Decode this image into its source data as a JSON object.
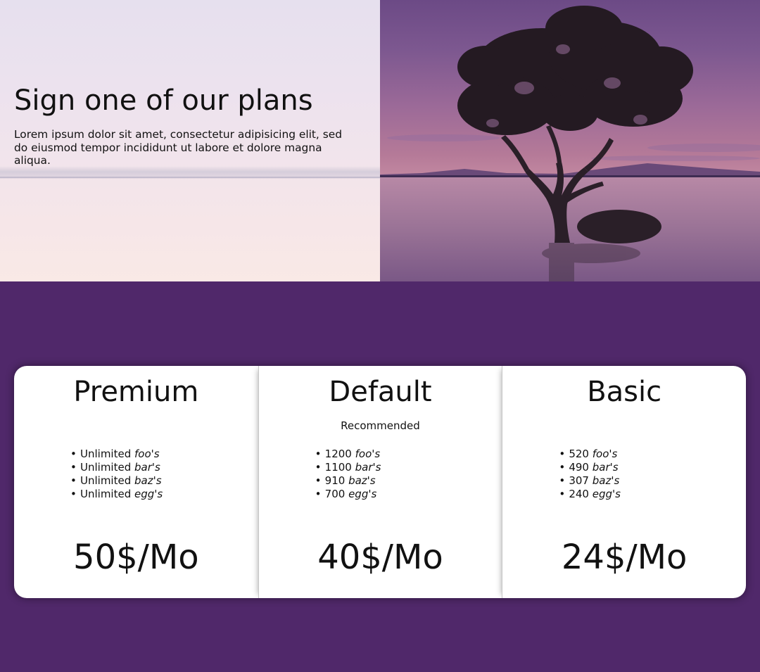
{
  "hero": {
    "title": "Sign one of our plans",
    "description": "Lorem ipsum dolor sit amet, consectetur adipisicing elit, sed do eiusmod tempor incididunt ut labore et dolore magna aliqua."
  },
  "plans": [
    {
      "name": "Premium",
      "tag": "",
      "features": [
        {
          "amount": "Unlimited",
          "unit": "foo's"
        },
        {
          "amount": "Unlimited",
          "unit": "bar's"
        },
        {
          "amount": "Unlimited",
          "unit": "baz's"
        },
        {
          "amount": "Unlimited",
          "unit": "egg's"
        }
      ],
      "price": "50$/Mo"
    },
    {
      "name": "Default",
      "tag": "Recommended",
      "features": [
        {
          "amount": "1200",
          "unit": "foo's"
        },
        {
          "amount": "1100",
          "unit": "bar's"
        },
        {
          "amount": "910",
          "unit": "baz's"
        },
        {
          "amount": "700",
          "unit": "egg's"
        }
      ],
      "price": "40$/Mo"
    },
    {
      "name": "Basic",
      "tag": "",
      "features": [
        {
          "amount": "520",
          "unit": "foo's"
        },
        {
          "amount": "490",
          "unit": "bar's"
        },
        {
          "amount": "307",
          "unit": "baz's"
        },
        {
          "amount": "240",
          "unit": "egg's"
        }
      ],
      "price": "24$/Mo"
    }
  ],
  "colors": {
    "background": "#50286a",
    "card": "#ffffff",
    "text": "#111111"
  }
}
